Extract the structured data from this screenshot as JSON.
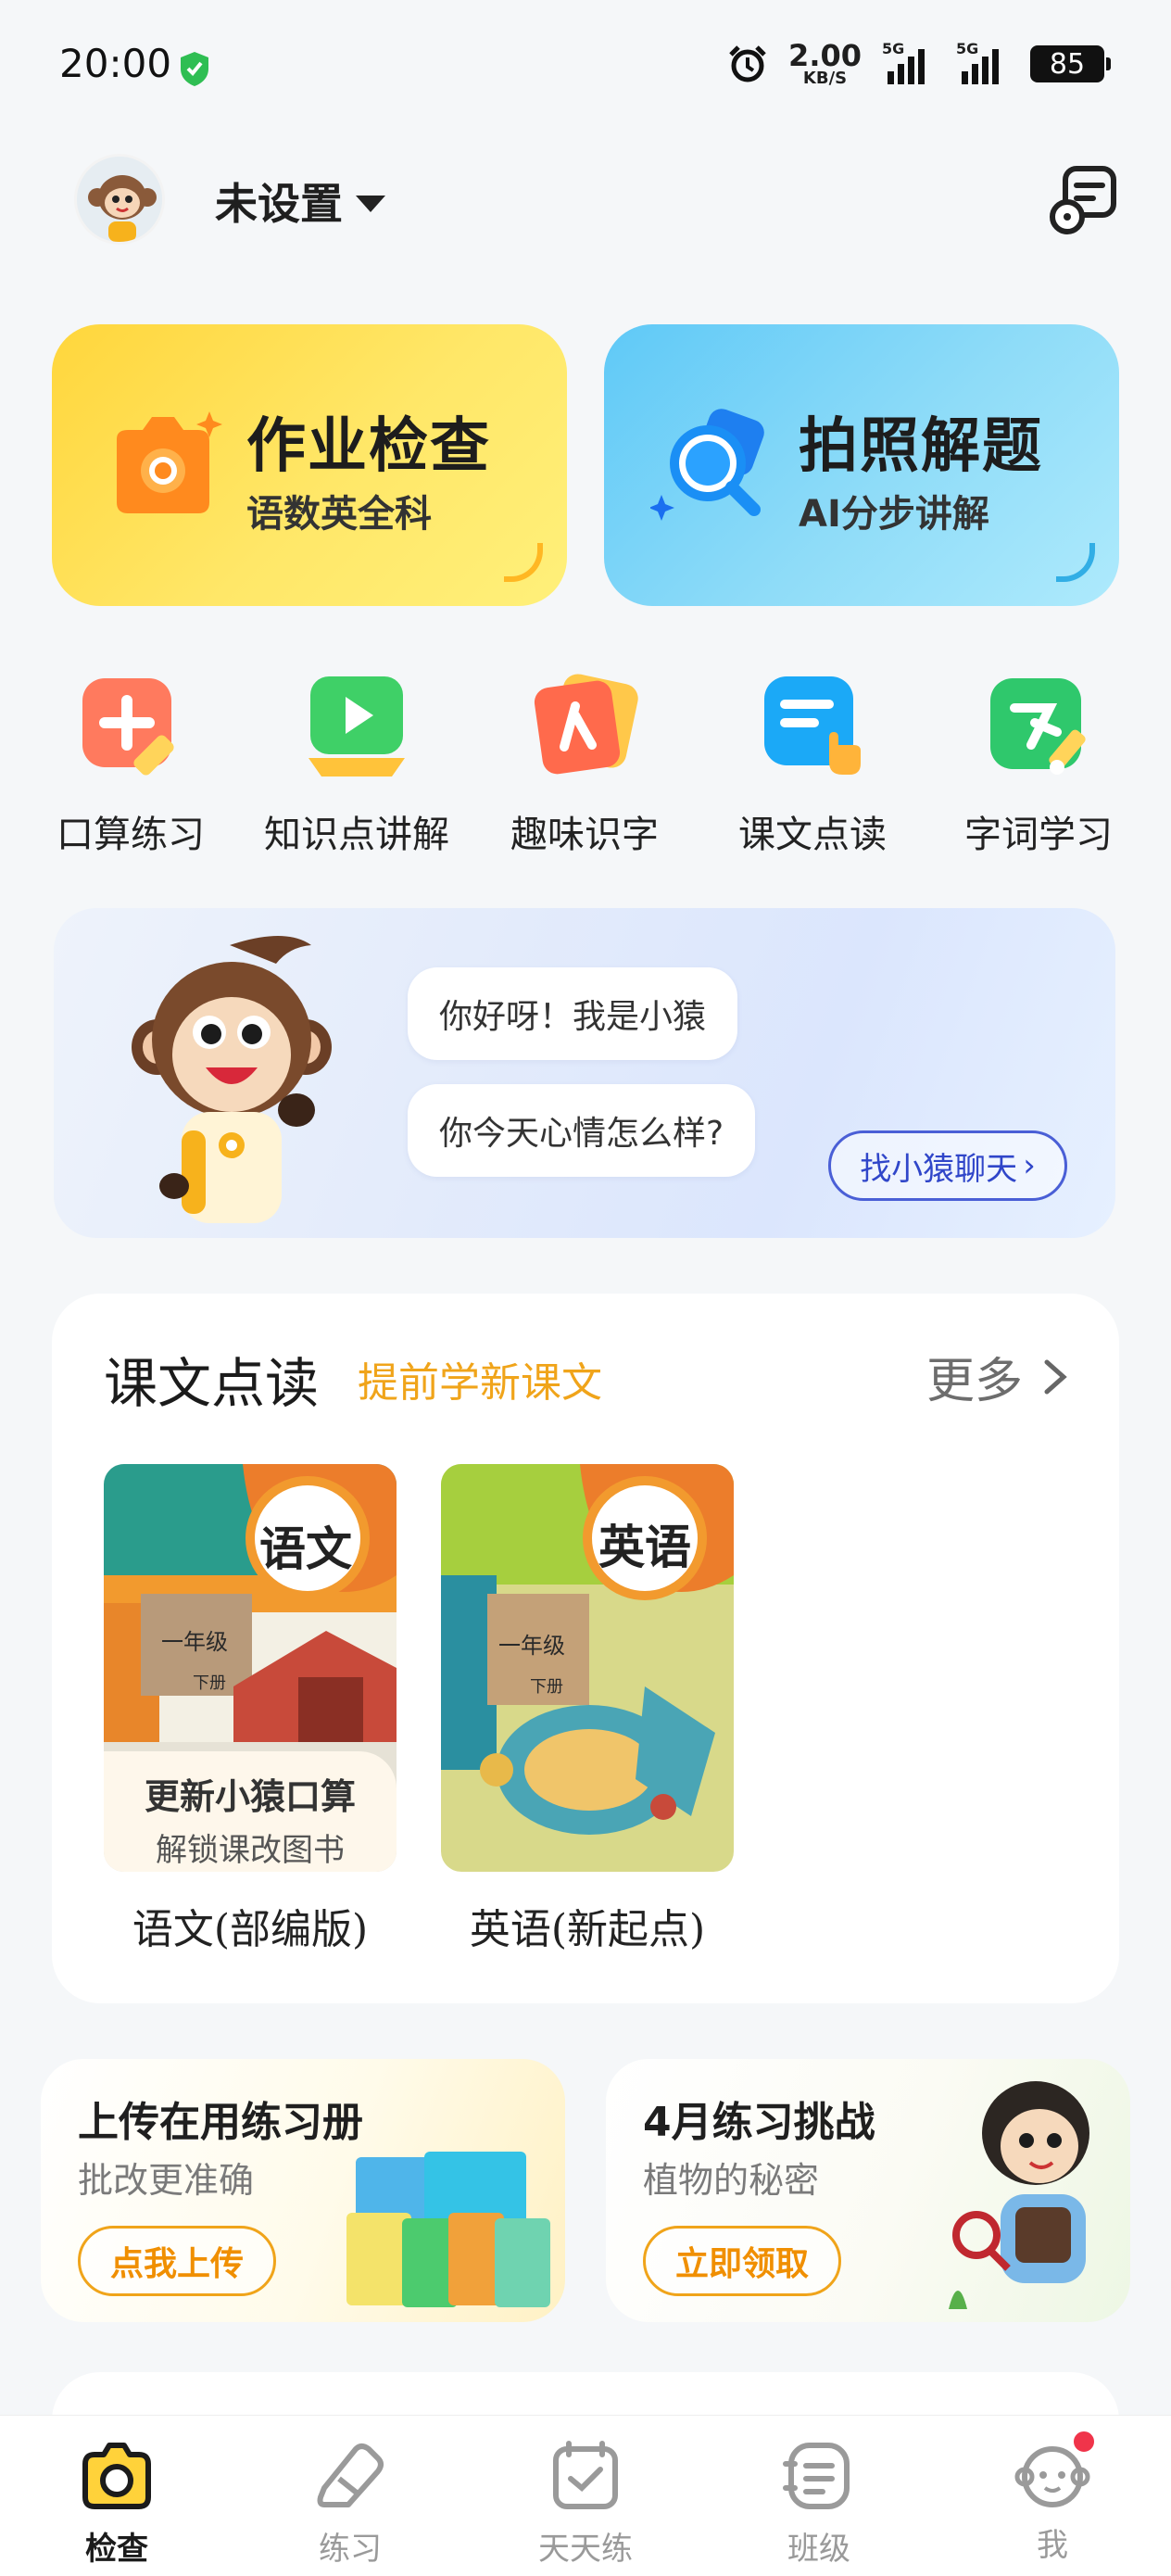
{
  "status_bar": {
    "time": "20:00",
    "speed_value": "2.00",
    "speed_unit": "KB/S",
    "network_1": "5G",
    "network_2": "5G",
    "battery": "85"
  },
  "header": {
    "profile_name": "未设置"
  },
  "hero_cards": [
    {
      "title": "作业检查",
      "subtitle": "语数英全科",
      "icon": "camera-icon",
      "color": "#ffd63c"
    },
    {
      "title": "拍照解题",
      "subtitle": "AI分步讲解",
      "icon": "magnifier-icon",
      "color": "#5fc9f7"
    }
  ],
  "quick_entries": [
    {
      "label": "口算练习",
      "icon": "plus-pencil-icon",
      "color": "#ff7a5e"
    },
    {
      "label": "知识点讲解",
      "icon": "play-icon",
      "color": "#3fd067"
    },
    {
      "label": "趣味识字",
      "icon": "character-card-icon",
      "color": "#ff6a4c"
    },
    {
      "label": "课文点读",
      "icon": "tap-reading-icon",
      "color": "#1ba9f7"
    },
    {
      "label": "字词学习",
      "icon": "word-brush-icon",
      "color": "#2fc86c"
    }
  ],
  "monkey_banner": {
    "greeting": "你好呀！我是小猿",
    "question": "你今天心情怎么样?",
    "chat_button": "找小猿聊天"
  },
  "reading_section": {
    "title": "课文点读",
    "subtitle": "提前学新课文",
    "more_label": "更多",
    "books": [
      {
        "name": "语文(部编版)",
        "cover_title": "语文",
        "grade": "一年级",
        "volume": "下册",
        "lock_line_1": "更新小猿口算",
        "lock_line_2": "解锁课改图书"
      },
      {
        "name": "英语(新起点)",
        "cover_title": "英语",
        "grade": "一年级",
        "volume": "下册"
      }
    ]
  },
  "promos": [
    {
      "title": "上传在用练习册",
      "subtitle": "批改更准确",
      "button": "点我上传"
    },
    {
      "title": "4月练习挑战",
      "subtitle": "植物的秘密",
      "button": "立即领取"
    }
  ],
  "bottom_nav": [
    {
      "label": "检查",
      "icon": "camera-icon",
      "active": true
    },
    {
      "label": "练习",
      "icon": "eraser-icon",
      "active": false
    },
    {
      "label": "天天练",
      "icon": "calendar-check-icon",
      "active": false
    },
    {
      "label": "班级",
      "icon": "class-list-icon",
      "active": false
    },
    {
      "label": "我",
      "icon": "monkey-face-icon",
      "active": false
    }
  ],
  "colors": {
    "accent_orange": "#f0a41a",
    "chat_blue": "#3046c9",
    "notification_red": "#f0344a"
  }
}
